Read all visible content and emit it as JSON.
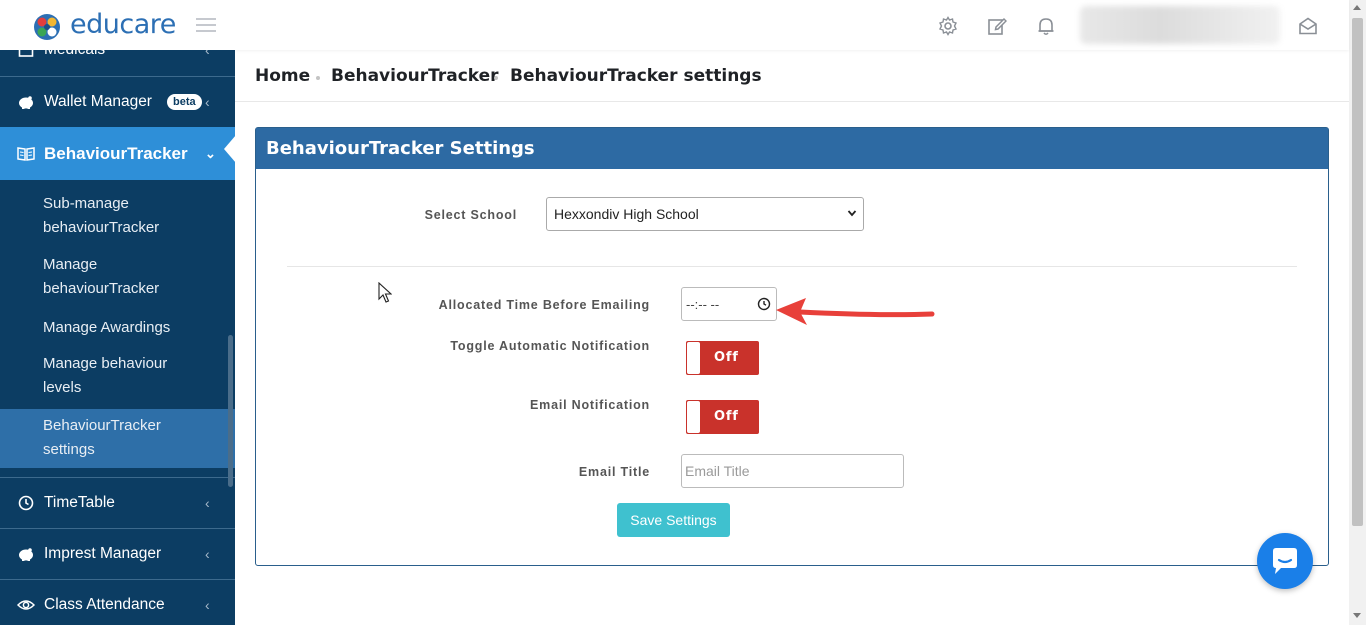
{
  "app": {
    "brand": "educare",
    "brand_color": "#2c6fb4"
  },
  "sidebar": {
    "items": [
      {
        "label": "Medicals",
        "icon": "medical-icon"
      },
      {
        "label": "Wallet Manager",
        "icon": "piggy-bank-icon",
        "badge": "beta"
      },
      {
        "label": "BehaviourTracker",
        "icon": "book-icon",
        "active": true
      },
      {
        "label": "TimeTable",
        "icon": "clock-icon"
      },
      {
        "label": "Imprest Manager",
        "icon": "piggy-bank-icon"
      },
      {
        "label": "Class Attendance",
        "icon": "eye-icon"
      }
    ],
    "subitems": [
      {
        "label": "Sub-manage behaviourTracker"
      },
      {
        "label": "Manage behaviourTracker"
      },
      {
        "label": "Manage Awardings"
      },
      {
        "label": "Manage behaviour levels"
      },
      {
        "label": "BehaviourTracker settings",
        "active": true
      }
    ],
    "colors": {
      "background": "#0c3d63",
      "active": "#2e8fd8",
      "sub_active": "#2e6fa8"
    }
  },
  "topbar": {
    "icons": [
      "gear-icon",
      "edit-icon",
      "bell-icon",
      "envelope-open-icon"
    ]
  },
  "breadcrumb": [
    "Home",
    "BehaviourTracker",
    "BehaviourTracker settings"
  ],
  "card": {
    "title": "BehaviourTracker Settings",
    "header_color": "#2d6aa3"
  },
  "form": {
    "school_label": "Select School",
    "school_value": "Hexxondiv High School",
    "time_label": "Allocated Time Before Emailing",
    "time_value": "--:-- --",
    "auto_notify_label": "Toggle Automatic Notification",
    "auto_notify_state": "Off",
    "email_notify_label": "Email Notification",
    "email_notify_state": "Off",
    "email_title_label": "Email Title",
    "email_title_placeholder": "Email Title",
    "save_label": "Save Settings"
  },
  "colors": {
    "toggle_off": "#c9322b",
    "save_button": "#3fc1cf",
    "chat_button": "#1a7fe8",
    "annotation_arrow": "#e8403a"
  }
}
